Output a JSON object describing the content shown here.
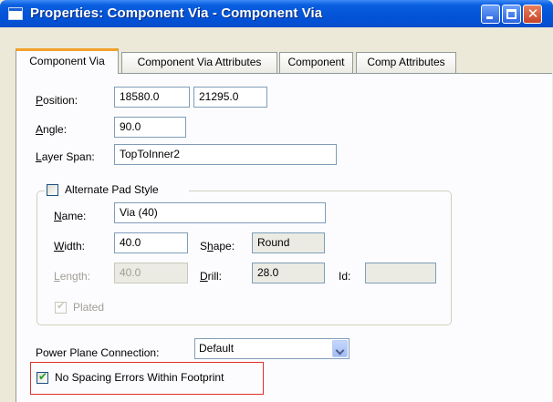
{
  "window": {
    "title": "Properties: Component Via - Component Via",
    "close_glyph": "✕"
  },
  "tabs": [
    {
      "label": "Component Via",
      "active": true
    },
    {
      "label": "Component Via Attributes",
      "active": false
    },
    {
      "label": "Component",
      "active": false
    },
    {
      "label": "Comp Attributes",
      "active": false
    }
  ],
  "position": {
    "label_u": "P",
    "label_rest": "osition:",
    "x": "18580.0",
    "y": "21295.0"
  },
  "angle": {
    "label_u": "A",
    "label_rest": "ngle:",
    "value": "90.0"
  },
  "layer_span": {
    "label_u": "L",
    "label_rest": "ayer Span:",
    "value": "TopToInner2"
  },
  "alternate_pad_style": {
    "label": "Alternate Pad Style",
    "checked": false
  },
  "name": {
    "label_u": "N",
    "label_rest": "ame:",
    "value": "Via (40)"
  },
  "width": {
    "label_u": "W",
    "label_rest": "idth:",
    "value": "40.0"
  },
  "shape": {
    "label_pre": "S",
    "label_u": "h",
    "label_rest": "ape:",
    "value": "Round"
  },
  "length": {
    "label_u": "L",
    "label_rest": "ength:",
    "value": "40.0",
    "disabled": true
  },
  "drill": {
    "label_u": "D",
    "label_rest": "rill:",
    "value": "28.0"
  },
  "id": {
    "label": "Id:",
    "value": ""
  },
  "plated": {
    "label": "Plated",
    "checked": true,
    "disabled": true
  },
  "power_plane_connection": {
    "label": "Power Plane Connection:",
    "value": "Default"
  },
  "no_spacing_errors": {
    "label": "No Spacing Errors Within Footprint",
    "checked": true
  },
  "colors": {
    "titlebar": "#0455d8",
    "active_tab_accent": "#f2a22a",
    "highlight_box": "#e0302a"
  }
}
